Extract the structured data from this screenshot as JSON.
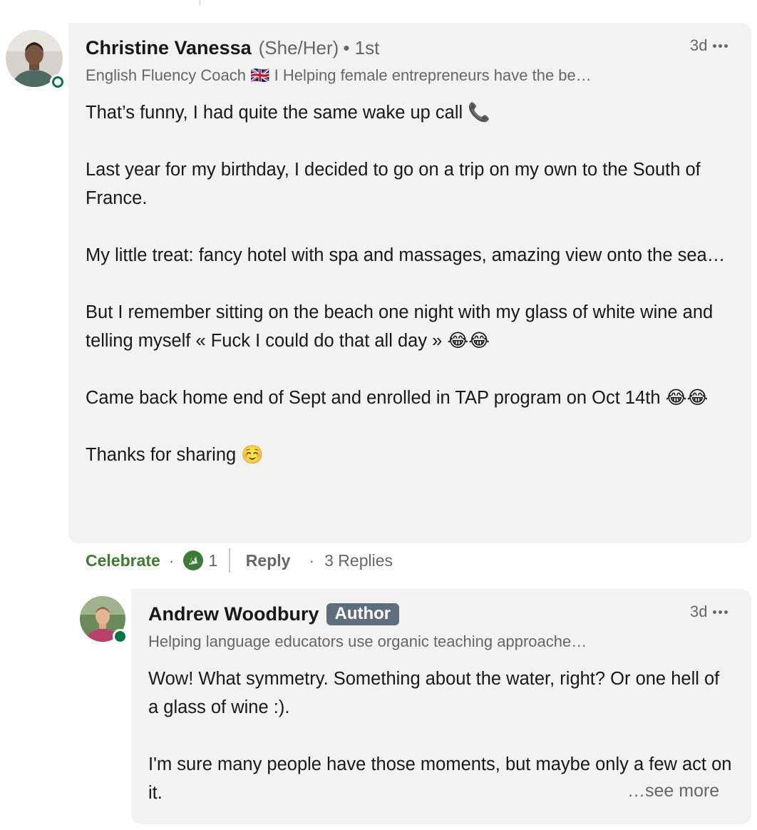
{
  "comment": {
    "author": {
      "name": "Christine Vanessa",
      "pronouns": "(She/Her)",
      "degree": "• 1st",
      "headline": "English Fluency Coach 🇬🇧 I Helping female entrepreneurs have the be…",
      "online": true
    },
    "time": "3d",
    "paragraphs": [
      "That’s funny, I had quite the same wake up call 📞",
      "Last year for my birthday, I decided to go on a trip on my own to the South of France.",
      "My little treat: fancy hotel with spa and massages, amazing view onto the sea…",
      "But I remember sitting on the beach one night with my glass of white wine and telling myself «  Fuck I could do that all day » 😂😂",
      "Came back home end of Sept and enrolled in TAP program on Oct 14th 😂😂",
      "Thanks for sharing ☺️"
    ],
    "actions": {
      "reaction_label": "Celebrate",
      "reaction_count": "1",
      "reply_label": "Reply",
      "replies_label": "3 Replies"
    }
  },
  "reply": {
    "author": {
      "name": "Andrew Woodbury",
      "badge": "Author",
      "headline": "Helping language educators use organic teaching approache…",
      "online": true
    },
    "time": "3d",
    "paragraphs": [
      "Wow! What symmetry. Something about the water, right? Or one hell of a glass of wine :).",
      "I'm sure many people have those moments, but maybe only a few act on it."
    ],
    "see_more": "…see more"
  },
  "colors": {
    "bubble": "#f2f2f2",
    "celebrate": "#3e7b2f",
    "presence": "#057642",
    "badge": "#5e6e7e",
    "muted": "#666666"
  }
}
